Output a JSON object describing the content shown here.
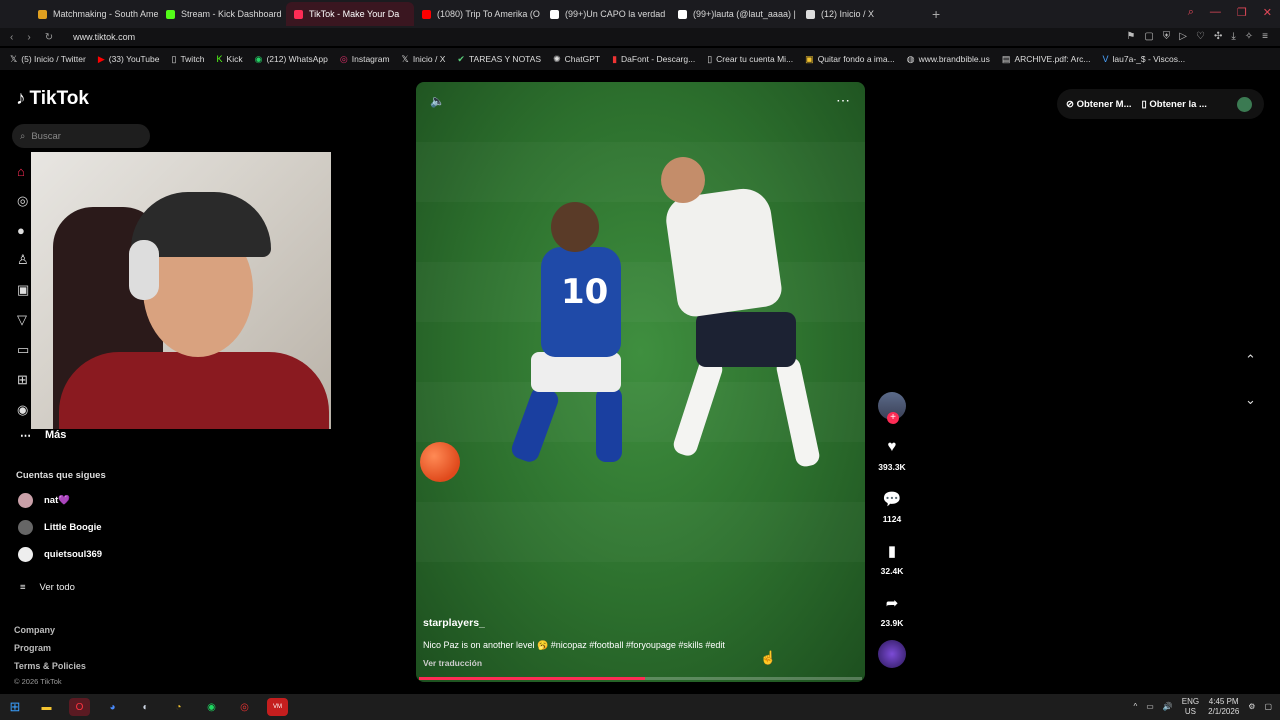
{
  "browser": {
    "tabs": [
      {
        "label": "Matchmaking - South Ame",
        "color": "#e0a020"
      },
      {
        "label": "Stream - Kick Dashboard",
        "color": "#53fc18"
      },
      {
        "label": "TikTok - Make Your Da",
        "color": "#fe2c55",
        "active": true
      },
      {
        "label": "(1080) Trip To Amerika (O",
        "color": "#ff0000"
      },
      {
        "label": "(99+)Un CAPO la verdad",
        "color": "#ffffff"
      },
      {
        "label": "(99+)lauta (@laut_aaaa) |",
        "color": "#ffffff"
      },
      {
        "label": "(12) Inicio / X",
        "color": "#dddddd"
      }
    ],
    "url": "www.tiktok.com",
    "bookmarks": [
      {
        "label": "(5) Inicio / Twitter",
        "icon": "x-icon"
      },
      {
        "label": "(33) YouTube",
        "icon": "youtube-icon"
      },
      {
        "label": "Twitch",
        "icon": "page-icon"
      },
      {
        "label": "Kick",
        "icon": "kick-icon"
      },
      {
        "label": "(212) WhatsApp",
        "icon": "whatsapp-icon"
      },
      {
        "label": "Instagram",
        "icon": "instagram-icon"
      },
      {
        "label": "Inicio / X",
        "icon": "x-icon"
      },
      {
        "label": "TAREAS Y NOTAS",
        "icon": "notes-icon"
      },
      {
        "label": "ChatGPT",
        "icon": "chatgpt-icon"
      },
      {
        "label": "DaFont - Descarg...",
        "icon": "dafont-icon"
      },
      {
        "label": "Crear tu cuenta Mi...",
        "icon": "page-icon"
      },
      {
        "label": "Quitar fondo a ima...",
        "icon": "image-icon"
      },
      {
        "label": "www.brandbible.us",
        "icon": "globe-icon"
      },
      {
        "label": "ARCHIVE.pdf: Arc...",
        "icon": "archive-icon"
      },
      {
        "label": "lau7a-_$ - Viscos...",
        "icon": "v-icon"
      }
    ]
  },
  "tiktok": {
    "logo": "TikTok",
    "search_placeholder": "Buscar",
    "more_label": "Más",
    "following_title": "Cuentas que sigues",
    "following": [
      {
        "name": "nat💜"
      },
      {
        "name": "Little Boogie"
      },
      {
        "name": "quietsoul369"
      }
    ],
    "see_all": "Ver todo",
    "footer": [
      "Company",
      "Program",
      "Terms & Policies"
    ],
    "copyright": "© 2026 TikTok",
    "top_actions": [
      "Obtener M...",
      "Obtener la ..."
    ]
  },
  "video": {
    "author": "starplayers_",
    "caption": "Nico Paz is on another level 🥱 #nicopaz #football #foryoupage #skills #edit",
    "translate": "Ver traducción",
    "jersey_number": "10",
    "progress": 0.51,
    "likes": "393.3K",
    "comments": "1124",
    "saves": "32.4K",
    "shares": "23.9K"
  },
  "taskbar": {
    "lang_line1": "ENG",
    "lang_line2": "US",
    "time": "4:45 PM",
    "date": "2/1/2026"
  },
  "colors": {
    "accent": "#fe2c55",
    "tab_active_bg": "#3a1620"
  }
}
